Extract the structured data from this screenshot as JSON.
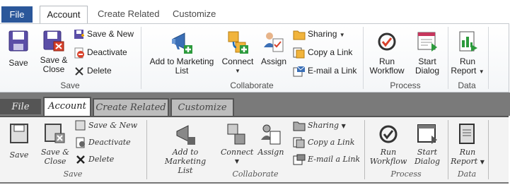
{
  "tabs": [
    "File",
    "Account",
    "Create Related",
    "Customize"
  ],
  "groups": {
    "save": {
      "label": "Save",
      "save": "Save",
      "save_close": [
        "Save &",
        "Close"
      ],
      "save_new": "Save & New",
      "deactivate": "Deactivate",
      "delete": "Delete"
    },
    "collaborate": {
      "label": "Collaborate",
      "add_marketing": [
        "Add to Marketing",
        "List"
      ],
      "connect": "Connect",
      "assign": "Assign",
      "sharing": "Sharing",
      "copy_link": "Copy a Link",
      "email_link": "E-mail a Link"
    },
    "process": {
      "label": "Process",
      "run_workflow": [
        "Run",
        "Workflow"
      ],
      "start_dialog": [
        "Start",
        "Dialog"
      ]
    },
    "data": {
      "label": "Data",
      "run_report": [
        "Run",
        "Report"
      ]
    }
  },
  "colors": {
    "file_tab": "#2b579a",
    "ribbon_border": "#c5c9ce"
  }
}
